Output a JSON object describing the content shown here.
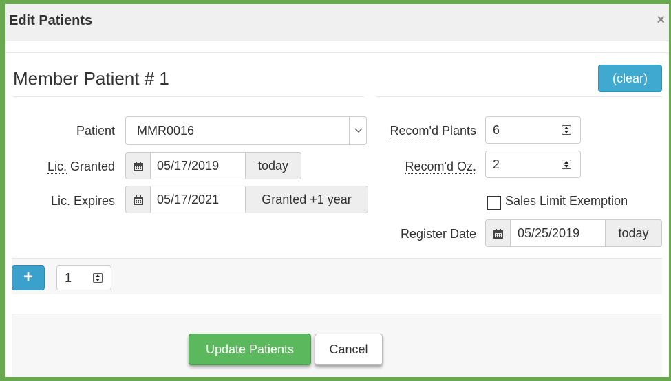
{
  "dialog": {
    "title": "Edit Patients",
    "close_glyph": "×"
  },
  "section": {
    "title": "Member Patient # 1",
    "clear_label": "(clear)"
  },
  "left_form": {
    "patient": {
      "label": "Patient",
      "value": "MMR0016"
    },
    "lic_granted": {
      "label_abbr": "Lic.",
      "label_rest": " Granted",
      "value": "05/17/2019",
      "button": "today"
    },
    "lic_expires": {
      "label_abbr": "Lic.",
      "label_rest": " Expires",
      "value": "05/17/2021",
      "button": "Granted +1 year"
    }
  },
  "right_form": {
    "recom_plants": {
      "label_abbr": "Recom'd",
      "label_rest": " Plants",
      "value": "6"
    },
    "recom_oz": {
      "label_abbr": "Recom'd Oz.",
      "value": "2"
    },
    "sales_limit": {
      "label": "Sales Limit Exemption",
      "checked": false
    },
    "register_date": {
      "label": "Register Date",
      "value": "05/25/2019",
      "button": "today"
    }
  },
  "add_row": {
    "plus_label": "+",
    "count": "1"
  },
  "footer": {
    "update_label": "Update Patients",
    "cancel_label": "Cancel"
  },
  "icons": {
    "calendar": "calendar-icon",
    "spinner": "spinner-icon",
    "chevron": "chevron-down-icon"
  },
  "colors": {
    "frame": "#6aa84f",
    "info": "#3fa9cf",
    "success": "#5cb85c"
  }
}
